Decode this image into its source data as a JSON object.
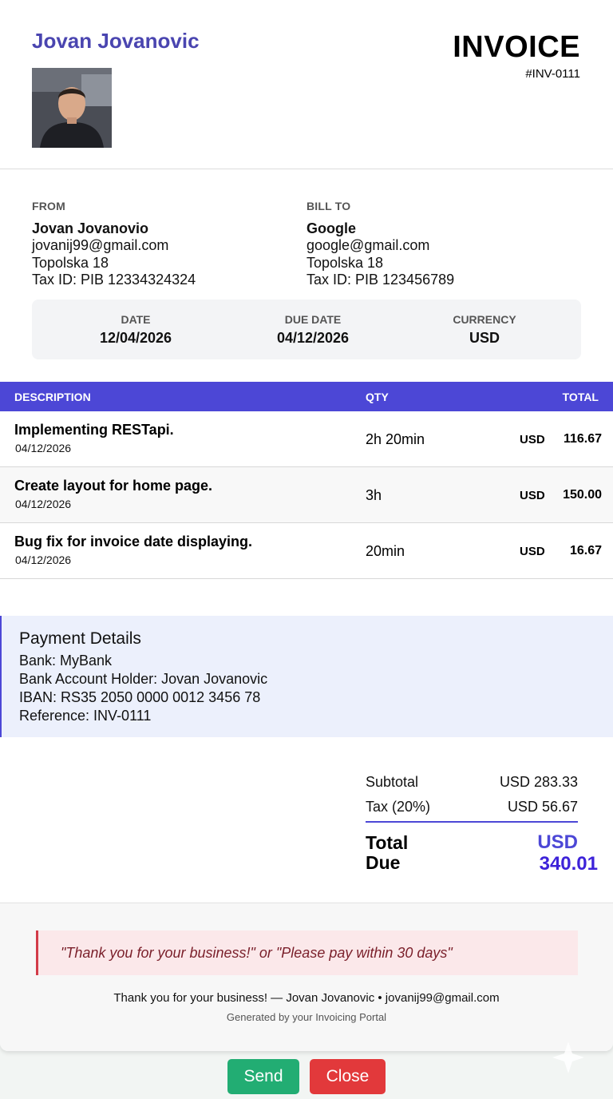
{
  "header": {
    "sender_name": "Jovan Jovanovic",
    "title": "INVOICE",
    "number": "#INV-0111"
  },
  "from": {
    "label": "FROM",
    "name": "Jovan Jovanovio",
    "email": "jovanij99@gmail.com",
    "address": "Topolska 18",
    "tax": "Tax ID: PIB 12334324324"
  },
  "bill_to": {
    "label": "BILL TO",
    "name": "Google",
    "email": "google@gmail.com",
    "address": "Topolska 18",
    "tax": "Tax ID: PIB 123456789"
  },
  "meta": {
    "date_label": "DATE",
    "date": "12/04/2026",
    "due_label": "DUE DATE",
    "due": "04/12/2026",
    "currency_label": "CURRENCY",
    "currency": "USD"
  },
  "table": {
    "headers": {
      "description": "DESCRIPTION",
      "qty": "QTY",
      "total": "TOTAL"
    },
    "rows": [
      {
        "description": "Implementing RESTapi.",
        "date": "04/12/2026",
        "qty": "2h 20min",
        "currency": "USD",
        "amount": "116.67"
      },
      {
        "description": "Create layout for home page.",
        "date": "04/12/2026",
        "qty": "3h",
        "currency": "USD",
        "amount": "150.00"
      },
      {
        "description": "Bug fix for invoice date displaying.",
        "date": "04/12/2026",
        "qty": "20min",
        "currency": "USD",
        "amount": "16.67"
      }
    ]
  },
  "payment": {
    "title": "Payment Details",
    "bank": "Bank: MyBank",
    "holder": "Bank Account Holder: Jovan Jovanovic",
    "iban": "IBAN: RS35 2050 0000 0012 3456 78",
    "reference": "Reference: INV-0111"
  },
  "totals": {
    "subtotal_label": "Subtotal",
    "subtotal": "USD 283.33",
    "tax_label": "Tax (20%)",
    "tax": "USD 56.67",
    "total_label": "Total Due",
    "total_currency": "USD",
    "total_value": "340.01"
  },
  "footer": {
    "note": "\"Thank you for your business!\" or \"Please pay within 30 days\"",
    "thanks": "Thank you for your business! — Jovan Jovanovic • jovanij99@gmail.com",
    "generated": "Generated by your Invoicing Portal"
  },
  "buttons": {
    "send": "Send",
    "close": "Close"
  },
  "colors": {
    "accent": "#4c47d6",
    "send": "#22ad73",
    "close": "#e2393b",
    "note_border": "#d23b48"
  }
}
